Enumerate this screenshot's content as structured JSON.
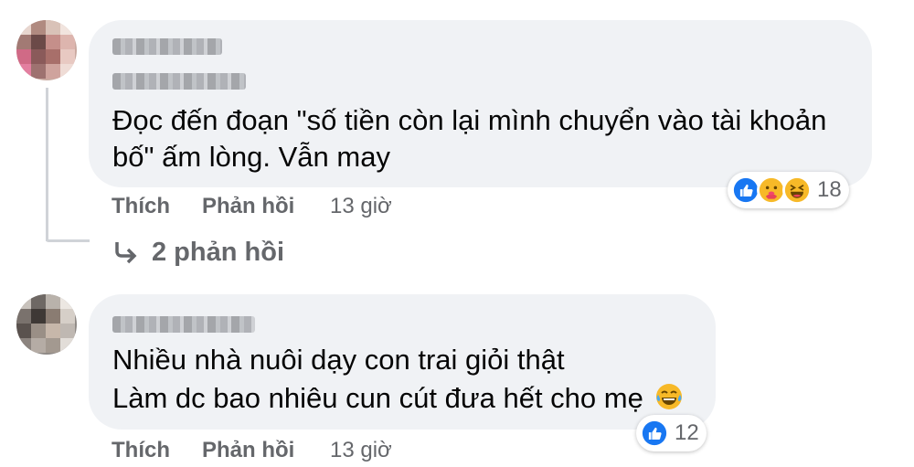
{
  "comments": [
    {
      "text_lines": [
        "Đọc đến đoạn \"số tiền còn lại mình chuyển vào tài khoản",
        "bố\" ấm lòng. Vẫn may"
      ],
      "actions": {
        "like": "Thích",
        "reply": "Phản hồi",
        "time": "13 giờ"
      },
      "reactions": {
        "icons": [
          "like-icon",
          "care-icon",
          "haha-icon"
        ],
        "count": "18"
      },
      "replies_label": "2 phản hồi"
    },
    {
      "text_lines": [
        "Nhiều nhà nuôi dạy con trai giỏi thật",
        "Làm dc bao nhiêu cun cút đưa hết cho mẹ"
      ],
      "actions": {
        "like": "Thích",
        "reply": "Phản hồi",
        "time": "13 giờ"
      },
      "reactions": {
        "icons": [
          "like-icon"
        ],
        "count": "12"
      },
      "trailing_emoji": "tears-of-joy-icon"
    }
  ],
  "colors": {
    "bubble": "#f0f2f5",
    "meta": "#65676b",
    "text": "#050505",
    "like_blue": "#1877f2",
    "haha_yellow": "#f7b928"
  }
}
